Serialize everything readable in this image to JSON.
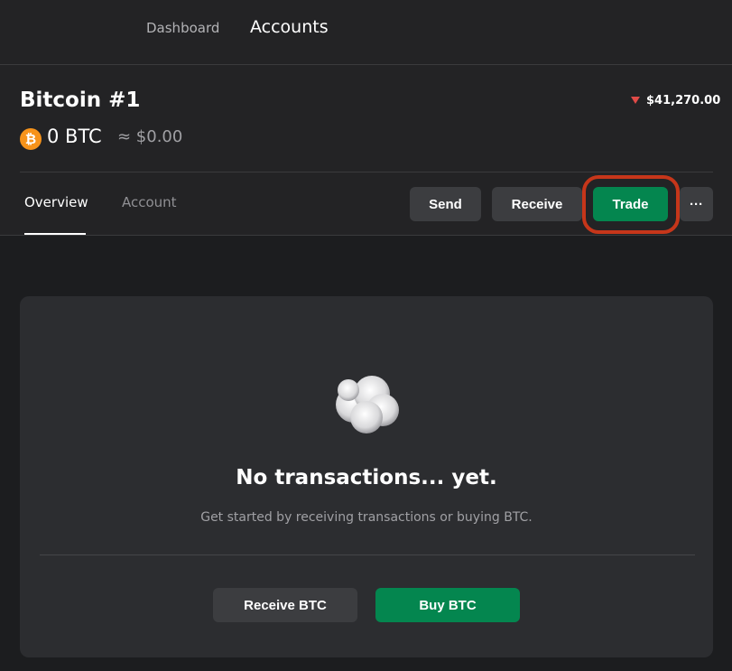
{
  "nav": {
    "dashboard": "Dashboard",
    "accounts": "Accounts"
  },
  "account": {
    "name": "Bitcoin #1",
    "coin_symbol": "₿",
    "balance": "0 BTC",
    "fiat_balance": "≈ $0.00",
    "price": "$41,270.00",
    "price_trend": "down-arrow-icon"
  },
  "tabs": [
    {
      "label": "Overview",
      "active": true
    },
    {
      "label": "Account",
      "active": false
    }
  ],
  "actions": {
    "send": "Send",
    "receive": "Receive",
    "trade": "Trade",
    "more": "···"
  },
  "empty_state": {
    "icon": "cloud-icon",
    "title": "No transactions... yet.",
    "subtitle": "Get started by receiving transactions or buying BTC.",
    "receive_btc": "Receive BTC",
    "buy_btc": "Buy BTC"
  },
  "colors": {
    "background": "#1c1d1f",
    "panel": "#232325",
    "card": "#2c2d30",
    "accent_green": "#04864f",
    "btc_orange": "#f7931a",
    "trend_down": "#e04a47",
    "highlight": "#c6361a"
  }
}
